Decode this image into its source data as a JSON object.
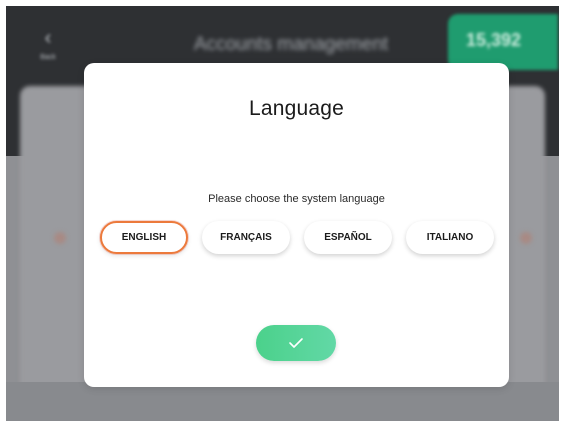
{
  "background": {
    "back_icon": "chevron-left-icon",
    "back_label": "Back",
    "title": "Accounts management",
    "balance": "15,392"
  },
  "dialog": {
    "title": "Language",
    "subtitle": "Please choose the system language",
    "languages": [
      {
        "label": "ENGLISH",
        "selected": true
      },
      {
        "label": "FRANÇAIS",
        "selected": false
      },
      {
        "label": "ESPAÑOL",
        "selected": false
      },
      {
        "label": "ITALIANO",
        "selected": false
      }
    ],
    "confirm_icon": "checkmark-icon"
  },
  "colors": {
    "selected_outline": "#ec7a3c",
    "confirm_button": "#4bd18b",
    "header": "#2e3033",
    "balance_badge": "#1f9c6f"
  }
}
